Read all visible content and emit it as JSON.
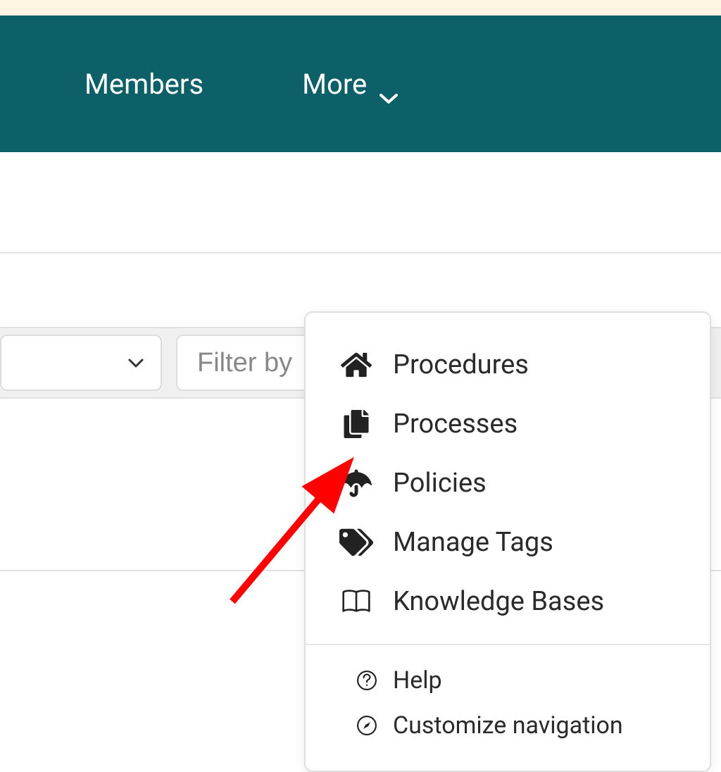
{
  "nav": {
    "members_label": "Members",
    "more_label": "More"
  },
  "filter": {
    "placeholder": "Filter by"
  },
  "dropdown": {
    "items": [
      {
        "icon": "home-icon",
        "label": "Procedures"
      },
      {
        "icon": "copy-icon",
        "label": "Processes"
      },
      {
        "icon": "umbrella-icon",
        "label": "Policies"
      },
      {
        "icon": "tags-icon",
        "label": "Manage Tags"
      },
      {
        "icon": "book-icon",
        "label": "Knowledge Bases"
      }
    ],
    "secondary": [
      {
        "icon": "question-icon",
        "label": "Help"
      },
      {
        "icon": "compass-icon",
        "label": "Customize navigation"
      }
    ]
  },
  "colors": {
    "nav_bg": "#0d6068",
    "banner_bg": "#fdf5e2",
    "arrow": "#ff0000"
  }
}
